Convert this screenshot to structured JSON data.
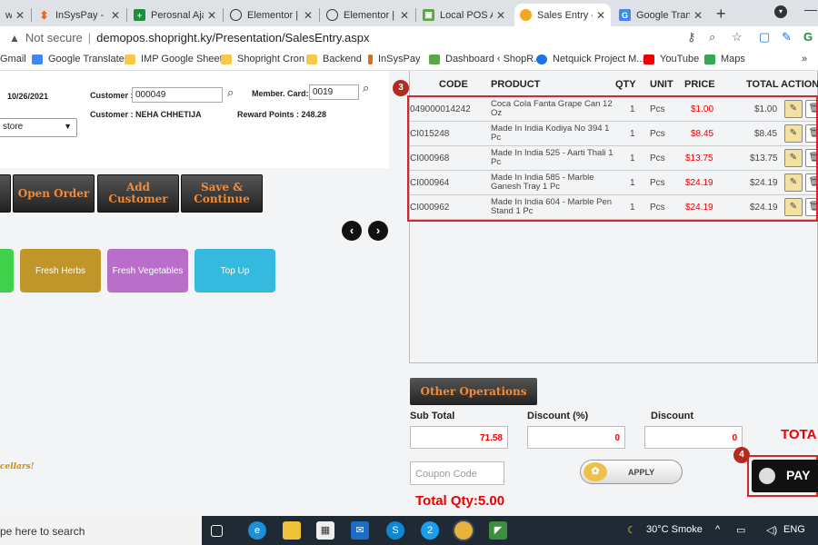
{
  "tabs": [
    {
      "title": "w",
      "active": false
    },
    {
      "title": "InSysPay - Bir",
      "active": false
    },
    {
      "title": "Perosnal Ajay",
      "active": false
    },
    {
      "title": "Elementor | H",
      "active": false
    },
    {
      "title": "Elementor | L",
      "active": false
    },
    {
      "title": "Local POS Ar",
      "active": false
    },
    {
      "title": "Sales Entry - (",
      "active": true
    },
    {
      "title": "Google Trans",
      "active": false
    }
  ],
  "tab_close": "✕",
  "new_tab": "+",
  "address": {
    "security": "Not secure",
    "url": "demopos.shopright.ky/Presentation/SalesEntry.aspx"
  },
  "bookmarks": [
    "Gmail",
    "Google Translate",
    "IMP Google Sheet",
    "Shopright Cron",
    "Backend",
    "InSysPay",
    "Dashboard ‹ ShopR...",
    "Netquick Project M...",
    "YouTube",
    "Maps",
    "»"
  ],
  "order": {
    "date": "10/26/2021",
    "customer_label": "Customer :",
    "customer_code": "000049",
    "customer_name_line": "Customer : NEHA CHHETIJA",
    "member_label": "Member. Card:",
    "member_card": "0019",
    "reward_points": "Reward Points : 248.28",
    "store": "store"
  },
  "action_buttons": {
    "open_order": "Open Order",
    "add_customer": "Add Customer",
    "save_continue": "Save & Continue"
  },
  "nav": {
    "prev": "‹",
    "next": "›"
  },
  "categories": [
    {
      "label": "",
      "color": "#3fd14a"
    },
    {
      "label": "Fresh Herbs",
      "color": "#c0962a"
    },
    {
      "label": "Fresh Vegetables",
      "color": "#b96ec9"
    },
    {
      "label": "Top Up",
      "color": "#35b9de"
    }
  ],
  "footer_text": "cellars!",
  "cart": {
    "headers": {
      "code": "CODE",
      "product": "PRODUCT",
      "qty": "QTY",
      "unit": "UNIT",
      "price": "PRICE",
      "total": "TOTAL ACTION"
    },
    "rows": [
      {
        "code": "049000014242",
        "product": "Coca Cola Fanta Grape Can 12 Oz",
        "qty": "1",
        "unit": "Pcs",
        "price": "$1.00",
        "total": "$1.00"
      },
      {
        "code": "CI015248",
        "product": "Made In India Kodiya No 394 1 Pc",
        "qty": "1",
        "unit": "Pcs",
        "price": "$8.45",
        "total": "$8.45"
      },
      {
        "code": "CI000968",
        "product": "Made In India 525 - Aarti Thali 1 Pc",
        "qty": "1",
        "unit": "Pcs",
        "price": "$13.75",
        "total": "$13.75"
      },
      {
        "code": "CI000964",
        "product": "Made In India 585 - Marble Ganesh Tray 1 Pc",
        "qty": "1",
        "unit": "Pcs",
        "price": "$24.19",
        "total": "$24.19"
      },
      {
        "code": "CI000962",
        "product": "Made In India 604 - Marble Pen Stand 1 Pc",
        "qty": "1",
        "unit": "Pcs",
        "price": "$24.19",
        "total": "$24.19"
      }
    ]
  },
  "annotations": {
    "cart_badge": "3",
    "pay_badge": "4"
  },
  "summary": {
    "other_operations": "Other Operations",
    "subtotal_label": "Sub Total",
    "subtotal_value": "71.58",
    "discount_pct_label": "Discount (%)",
    "discount_pct_value": "0",
    "discount_label": "Discount",
    "discount_value": "0",
    "total_label": "TOTA",
    "coupon_placeholder": "Coupon Code",
    "apply_label": "APPLY",
    "total_qty": "Total Qty:5.00",
    "pay_label": "PAY"
  },
  "taskbar": {
    "search_text": "pe here to search",
    "weather": "30°C  Smoke",
    "lang": "ENG"
  }
}
